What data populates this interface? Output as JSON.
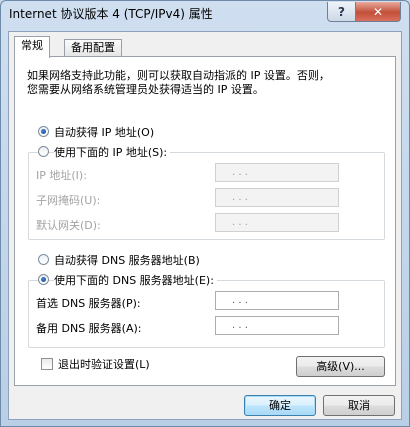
{
  "window": {
    "title": "Internet 协议版本 4 (TCP/IPv4) 属性",
    "help_label": "?",
    "close_label": "✕"
  },
  "tabs": [
    {
      "label": "常规",
      "active": true
    },
    {
      "label": "备用配置",
      "active": false
    }
  ],
  "description": "如果网络支持此功能，则可以获取自动指派的 IP 设置。否则，\n您需要从网络系统管理员处获得适当的 IP 设置。",
  "ip_section": {
    "auto_label": "自动获得 IP 地址(O)",
    "auto_selected": true,
    "manual_label": "使用下面的 IP 地址(S):",
    "manual_selected": false,
    "fields": [
      {
        "label": "IP 地址(I):",
        "value": ". . .",
        "enabled": false
      },
      {
        "label": "子网掩码(U):",
        "value": ". . .",
        "enabled": false
      },
      {
        "label": "默认网关(D):",
        "value": ". . .",
        "enabled": false
      }
    ]
  },
  "dns_section": {
    "auto_label": "自动获得 DNS 服务器地址(B)",
    "auto_selected": false,
    "manual_label": "使用下面的 DNS 服务器地址(E):",
    "manual_selected": true,
    "fields": [
      {
        "label": "首选 DNS 服务器(P):",
        "value": ". . .",
        "enabled": true
      },
      {
        "label": "备用 DNS 服务器(A):",
        "value": ". . .",
        "enabled": true
      }
    ]
  },
  "validate_label": "退出时验证设置(L)",
  "validate_checked": false,
  "buttons": {
    "advanced": "高级(V)...",
    "ok": "确定",
    "cancel": "取消"
  }
}
